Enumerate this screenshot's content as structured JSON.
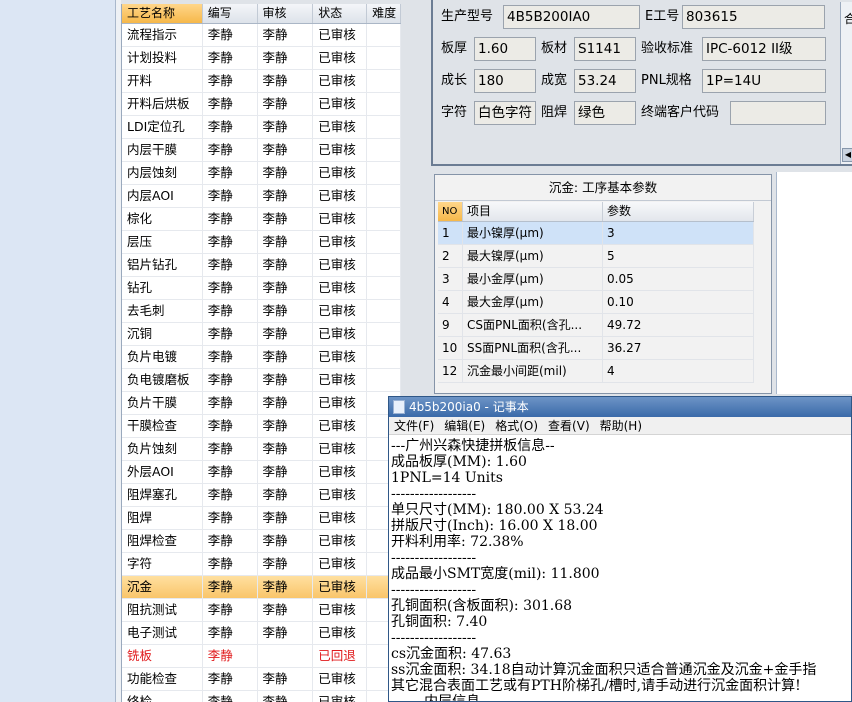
{
  "grid": {
    "headers": [
      "工艺名称",
      "编写",
      "审核",
      "状态",
      "难度"
    ],
    "rows": [
      {
        "name": "流程指示",
        "writer": "李静",
        "reviewer": "李静",
        "status": "已审核",
        "difficulty": ""
      },
      {
        "name": "计划投料",
        "writer": "李静",
        "reviewer": "李静",
        "status": "已审核",
        "difficulty": ""
      },
      {
        "name": "开料",
        "writer": "李静",
        "reviewer": "李静",
        "status": "已审核",
        "difficulty": ""
      },
      {
        "name": "开料后烘板",
        "writer": "李静",
        "reviewer": "李静",
        "status": "已审核",
        "difficulty": ""
      },
      {
        "name": "LDI定位孔",
        "writer": "李静",
        "reviewer": "李静",
        "status": "已审核",
        "difficulty": ""
      },
      {
        "name": "内层干膜",
        "writer": "李静",
        "reviewer": "李静",
        "status": "已审核",
        "difficulty": ""
      },
      {
        "name": "内层蚀刻",
        "writer": "李静",
        "reviewer": "李静",
        "status": "已审核",
        "difficulty": ""
      },
      {
        "name": "内层AOI",
        "writer": "李静",
        "reviewer": "李静",
        "status": "已审核",
        "difficulty": ""
      },
      {
        "name": "棕化",
        "writer": "李静",
        "reviewer": "李静",
        "status": "已审核",
        "difficulty": ""
      },
      {
        "name": "层压",
        "writer": "李静",
        "reviewer": "李静",
        "status": "已审核",
        "difficulty": ""
      },
      {
        "name": "铝片钻孔",
        "writer": "李静",
        "reviewer": "李静",
        "status": "已审核",
        "difficulty": ""
      },
      {
        "name": "钻孔",
        "writer": "李静",
        "reviewer": "李静",
        "status": "已审核",
        "difficulty": ""
      },
      {
        "name": "去毛刺",
        "writer": "李静",
        "reviewer": "李静",
        "status": "已审核",
        "difficulty": ""
      },
      {
        "name": "沉铜",
        "writer": "李静",
        "reviewer": "李静",
        "status": "已审核",
        "difficulty": ""
      },
      {
        "name": "负片电镀",
        "writer": "李静",
        "reviewer": "李静",
        "status": "已审核",
        "difficulty": ""
      },
      {
        "name": "负电镀磨板",
        "writer": "李静",
        "reviewer": "李静",
        "status": "已审核",
        "difficulty": ""
      },
      {
        "name": "负片干膜",
        "writer": "李静",
        "reviewer": "李静",
        "status": "已审核",
        "difficulty": ""
      },
      {
        "name": "干膜检查",
        "writer": "李静",
        "reviewer": "李静",
        "status": "已审核",
        "difficulty": ""
      },
      {
        "name": "负片蚀刻",
        "writer": "李静",
        "reviewer": "李静",
        "status": "已审核",
        "difficulty": ""
      },
      {
        "name": "外层AOI",
        "writer": "李静",
        "reviewer": "李静",
        "status": "已审核",
        "difficulty": ""
      },
      {
        "name": "阻焊塞孔",
        "writer": "李静",
        "reviewer": "李静",
        "status": "已审核",
        "difficulty": ""
      },
      {
        "name": "阻焊",
        "writer": "李静",
        "reviewer": "李静",
        "status": "已审核",
        "difficulty": ""
      },
      {
        "name": "阻焊检查",
        "writer": "李静",
        "reviewer": "李静",
        "status": "已审核",
        "difficulty": ""
      },
      {
        "name": "字符",
        "writer": "李静",
        "reviewer": "李静",
        "status": "已审核",
        "difficulty": ""
      },
      {
        "name": "沉金",
        "writer": "李静",
        "reviewer": "李静",
        "status": "已审核",
        "difficulty": "",
        "selected": true
      },
      {
        "name": "阻抗测试",
        "writer": "李静",
        "reviewer": "李静",
        "status": "已审核",
        "difficulty": ""
      },
      {
        "name": "电子测试",
        "writer": "李静",
        "reviewer": "李静",
        "status": "已审核",
        "difficulty": ""
      },
      {
        "name": "铣板",
        "writer": "李静",
        "reviewer": "",
        "status": "已回退",
        "difficulty": "",
        "returned": true
      },
      {
        "name": "功能检查",
        "writer": "李静",
        "reviewer": "李静",
        "status": "已审核",
        "difficulty": ""
      },
      {
        "name": "终检",
        "writer": "李静",
        "reviewer": "李静",
        "status": "已审核",
        "difficulty": ""
      }
    ]
  },
  "info": {
    "model_label": "生产型号",
    "model_value": "4B5B200IA0",
    "eno_label": "E工号",
    "eno_value": "803615",
    "cut_label": "合",
    "thickness_label": "板厚",
    "thickness_value": "1.60",
    "material_label": "板材",
    "material_value": "S1141",
    "standard_label": "验收标准",
    "standard_value": "IPC-6012 II级",
    "length_label": "成长",
    "length_value": "180",
    "width_label": "成宽",
    "width_value": "53.24",
    "pnl_label": "PNL规格",
    "pnl_value": "1P=14U",
    "char_label": "字符",
    "char_value": "白色字符",
    "mask_label": "阻焊",
    "mask_value": "绿色",
    "customer_label": "终端客户代码",
    "customer_value": ""
  },
  "params": {
    "title": "沉金: 工序基本参数",
    "headers": [
      "NO",
      "项目",
      "参数"
    ],
    "rows": [
      {
        "no": "1",
        "item": "最小镍厚(μm)",
        "value": "3",
        "selected": true
      },
      {
        "no": "2",
        "item": "最大镍厚(μm)",
        "value": "5"
      },
      {
        "no": "3",
        "item": "最小金厚(μm)",
        "value": "0.05"
      },
      {
        "no": "4",
        "item": "最大金厚(μm)",
        "value": "0.10"
      },
      {
        "no": "9",
        "item": "CS面PNL面积(含孔...",
        "value": "49.72"
      },
      {
        "no": "10",
        "item": "SS面PNL面积(含孔...",
        "value": "36.27"
      },
      {
        "no": "12",
        "item": "沉金最小间距(mil)",
        "value": "4"
      }
    ]
  },
  "notepad": {
    "title": "4b5b200ia0 - 记事本",
    "menu": [
      "文件(F)",
      "编辑(E)",
      "格式(O)",
      "查看(V)",
      "帮助(H)"
    ],
    "lines": [
      "---广州兴森快捷拼板信息--",
      "成品板厚(MM): 1.60",
      "1PNL=14 Units",
      "------------------",
      "单只尺寸(MM): 180.00 X 53.24",
      "拼版尺寸(Inch): 16.00 X 18.00",
      "开料利用率: 72.38%",
      "------------------",
      "成品最小SMT宽度(mil): 11.800",
      "------------------",
      "孔铜面积(含板面积): 301.68",
      "孔铜面积: 7.40",
      "------------------",
      "cs沉金面积: 47.63",
      "ss沉金面积: 34.18自动计算沉金面积只适合普通沉金及沉金+金手指",
      "其它混合表面工艺或有PTH阶梯孔/槽时,请手动进行沉金面积计算!",
      "-------内层信息-----"
    ]
  }
}
